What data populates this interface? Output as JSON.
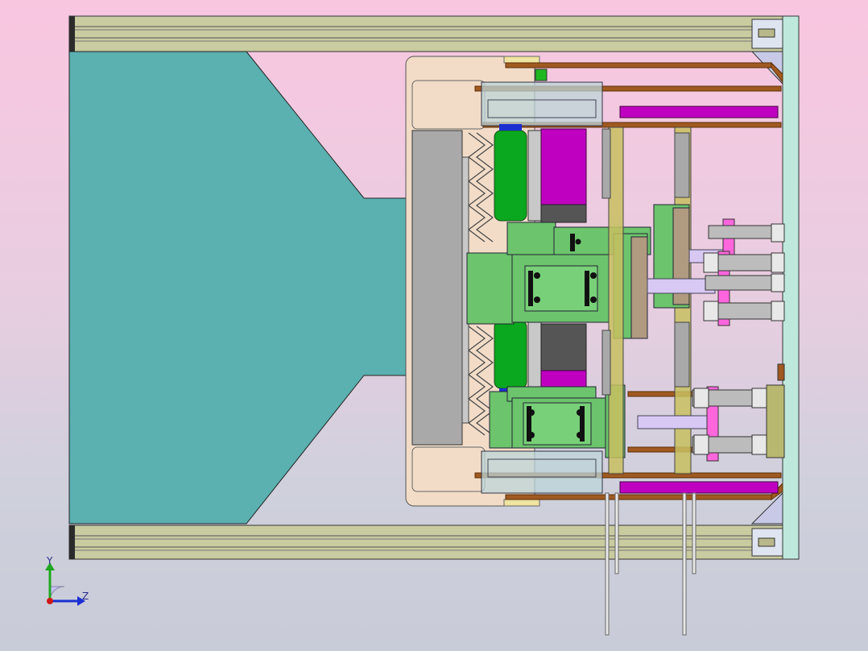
{
  "viewer": {
    "title": "",
    "view_orientation": "side"
  },
  "triad": {
    "y_label": "Y",
    "z_label": "Z",
    "x_color": "#d01818",
    "y_color": "#1fa81f",
    "z_color": "#1a2fd0"
  },
  "palette": {
    "rail": "#c9cba0",
    "rail_dark": "#2b2b2b",
    "nozzle": "#5bb0b0",
    "mold_plate": "#f2dcc8",
    "green_block": "#6cc46c",
    "bright_green": "#0aa81e",
    "magenta": "#c000c0",
    "pink": "#ff66dd",
    "copper": "#a05a20",
    "olive": "#c8c060",
    "grey_plate": "#a9a9a9",
    "end_plate": "#bfe8dc",
    "lavender": "#d8c8f4"
  }
}
